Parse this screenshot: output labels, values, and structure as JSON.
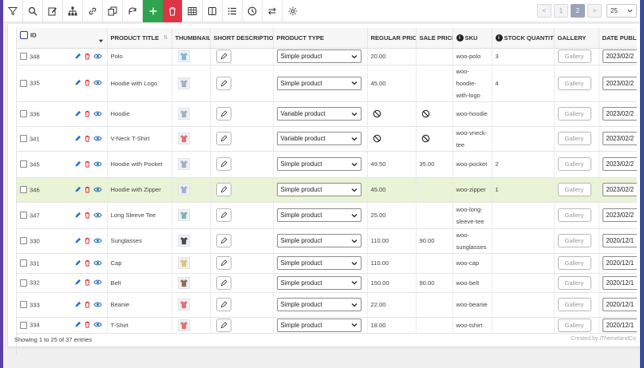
{
  "colors": {
    "accent_left": "#5b3fa5",
    "add_green": "#2ea44f",
    "delete_red": "#dc3545",
    "highlight_row": "#e9f3d5",
    "edit_icon": "#2a6bd1",
    "trash_icon": "#d63638",
    "view_icon": "#2271b1"
  },
  "toolbar": {
    "buttons": [
      {
        "icon": "filter-icon"
      },
      {
        "icon": "search-icon"
      },
      {
        "icon": "bulk-edit-icon"
      },
      {
        "icon": "hierarchy-icon"
      },
      {
        "icon": "link-icon"
      },
      {
        "icon": "duplicate-icon"
      },
      {
        "icon": "reload-icon"
      },
      {
        "icon": "plus-icon"
      },
      {
        "icon": "trash-icon"
      },
      {
        "icon": "table-columns-icon"
      },
      {
        "icon": "column-profile-icon"
      },
      {
        "icon": "list-icon"
      },
      {
        "icon": "history-icon"
      },
      {
        "icon": "import-export-icon"
      },
      {
        "icon": "settings-icon"
      }
    ]
  },
  "pagination": {
    "prev": "<",
    "page1": "1",
    "page2": "2",
    "next": ">",
    "per_page": "25"
  },
  "table": {
    "headers": {
      "id": "ID",
      "title": "PRODUCT TITLE",
      "thumbnail": "THUMBNAIL",
      "short_desc": "SHORT DESCRIPTION",
      "type": "PRODUCT TYPE",
      "regular_price": "REGULAR PRICE",
      "sale_price": "SALE PRICE",
      "sku": "SKU",
      "stock": "STOCK QUANTITY",
      "gallery": "GALLERY",
      "date": "DATE PUBLISHED"
    },
    "gallery_label": "Gallery",
    "rows": [
      {
        "id": "348",
        "title": "Polo",
        "thumb": "polo-shirt-icon",
        "type": "Simple product",
        "regular": "20.00",
        "sale": "",
        "sku": "woo-polo",
        "stock": "3",
        "date": "2023/02/2"
      },
      {
        "id": "335",
        "title": "Hoodie with Logo",
        "thumb": "hoodie-icon",
        "type": "Simple product",
        "regular": "45.00",
        "sale": "",
        "sku": "woo-hoodie-with-logo",
        "stock": "4",
        "date": "2023/02/2"
      },
      {
        "id": "336",
        "title": "Hoodie",
        "thumb": "hoodie-icon",
        "type": "Variable product",
        "regular": "",
        "sale": "",
        "sku": "woo-hoodie",
        "stock": "",
        "date": "2023/02/2"
      },
      {
        "id": "341",
        "title": "V-Neck T-Shirt",
        "thumb": "tshirt-icon",
        "type": "Variable product",
        "regular": "",
        "sale": "",
        "sku": "woo-vneck-tee",
        "stock": "",
        "date": "2023/02/2"
      },
      {
        "id": "345",
        "title": "Hoodie with Pocket",
        "thumb": "hoodie-icon",
        "type": "Simple product",
        "regular": "49.50",
        "sale": "35.00",
        "sku": "woo-pocket",
        "stock": "2",
        "date": "2023/02/2"
      },
      {
        "id": "346",
        "title": "Hoodie with Zipper",
        "thumb": "hoodie-icon",
        "type": "Simple product",
        "regular": "45.00",
        "sale": "",
        "sku": "woo-zipper",
        "stock": "1",
        "date": "2023/02/2"
      },
      {
        "id": "347",
        "title": "Long Sleeve Tee",
        "thumb": "longsleeve-icon",
        "type": "Simple product",
        "regular": "25.00",
        "sale": "",
        "sku": "woo-long-sleeve-tee",
        "stock": "",
        "date": "2023/02/2"
      },
      {
        "id": "330",
        "title": "Sunglasses",
        "thumb": "sunglasses-icon",
        "type": "Simple product",
        "regular": "110.00",
        "sale": "90.00",
        "sku": "woo-sunglasses",
        "stock": "",
        "date": "2020/12/1"
      },
      {
        "id": "331",
        "title": "Cap",
        "thumb": "cap-icon",
        "type": "Simple product",
        "regular": "110.00",
        "sale": "",
        "sku": "woo-cap",
        "stock": "",
        "date": "2020/12/1"
      },
      {
        "id": "332",
        "title": "Belt",
        "thumb": "belt-icon",
        "type": "Simple product",
        "regular": "150.00",
        "sale": "90.00",
        "sku": "woo-belt",
        "stock": "",
        "date": "2020/12/1"
      },
      {
        "id": "333",
        "title": "Beanie",
        "thumb": "beanie-icon",
        "type": "Simple product",
        "regular": "22.00",
        "sale": "",
        "sku": "woo-beanie",
        "stock": "",
        "date": "2020/12/1"
      },
      {
        "id": "334",
        "title": "T-Shirt",
        "thumb": "tshirt-icon",
        "type": "Simple product",
        "regular": "18.00",
        "sale": "",
        "sku": "woo-tshirt",
        "stock": "",
        "date": "2020/12/1"
      }
    ]
  },
  "footer": {
    "entries": "Showing 1 to 25 of 37 entries",
    "credit": "Created by iThemelandCo"
  }
}
